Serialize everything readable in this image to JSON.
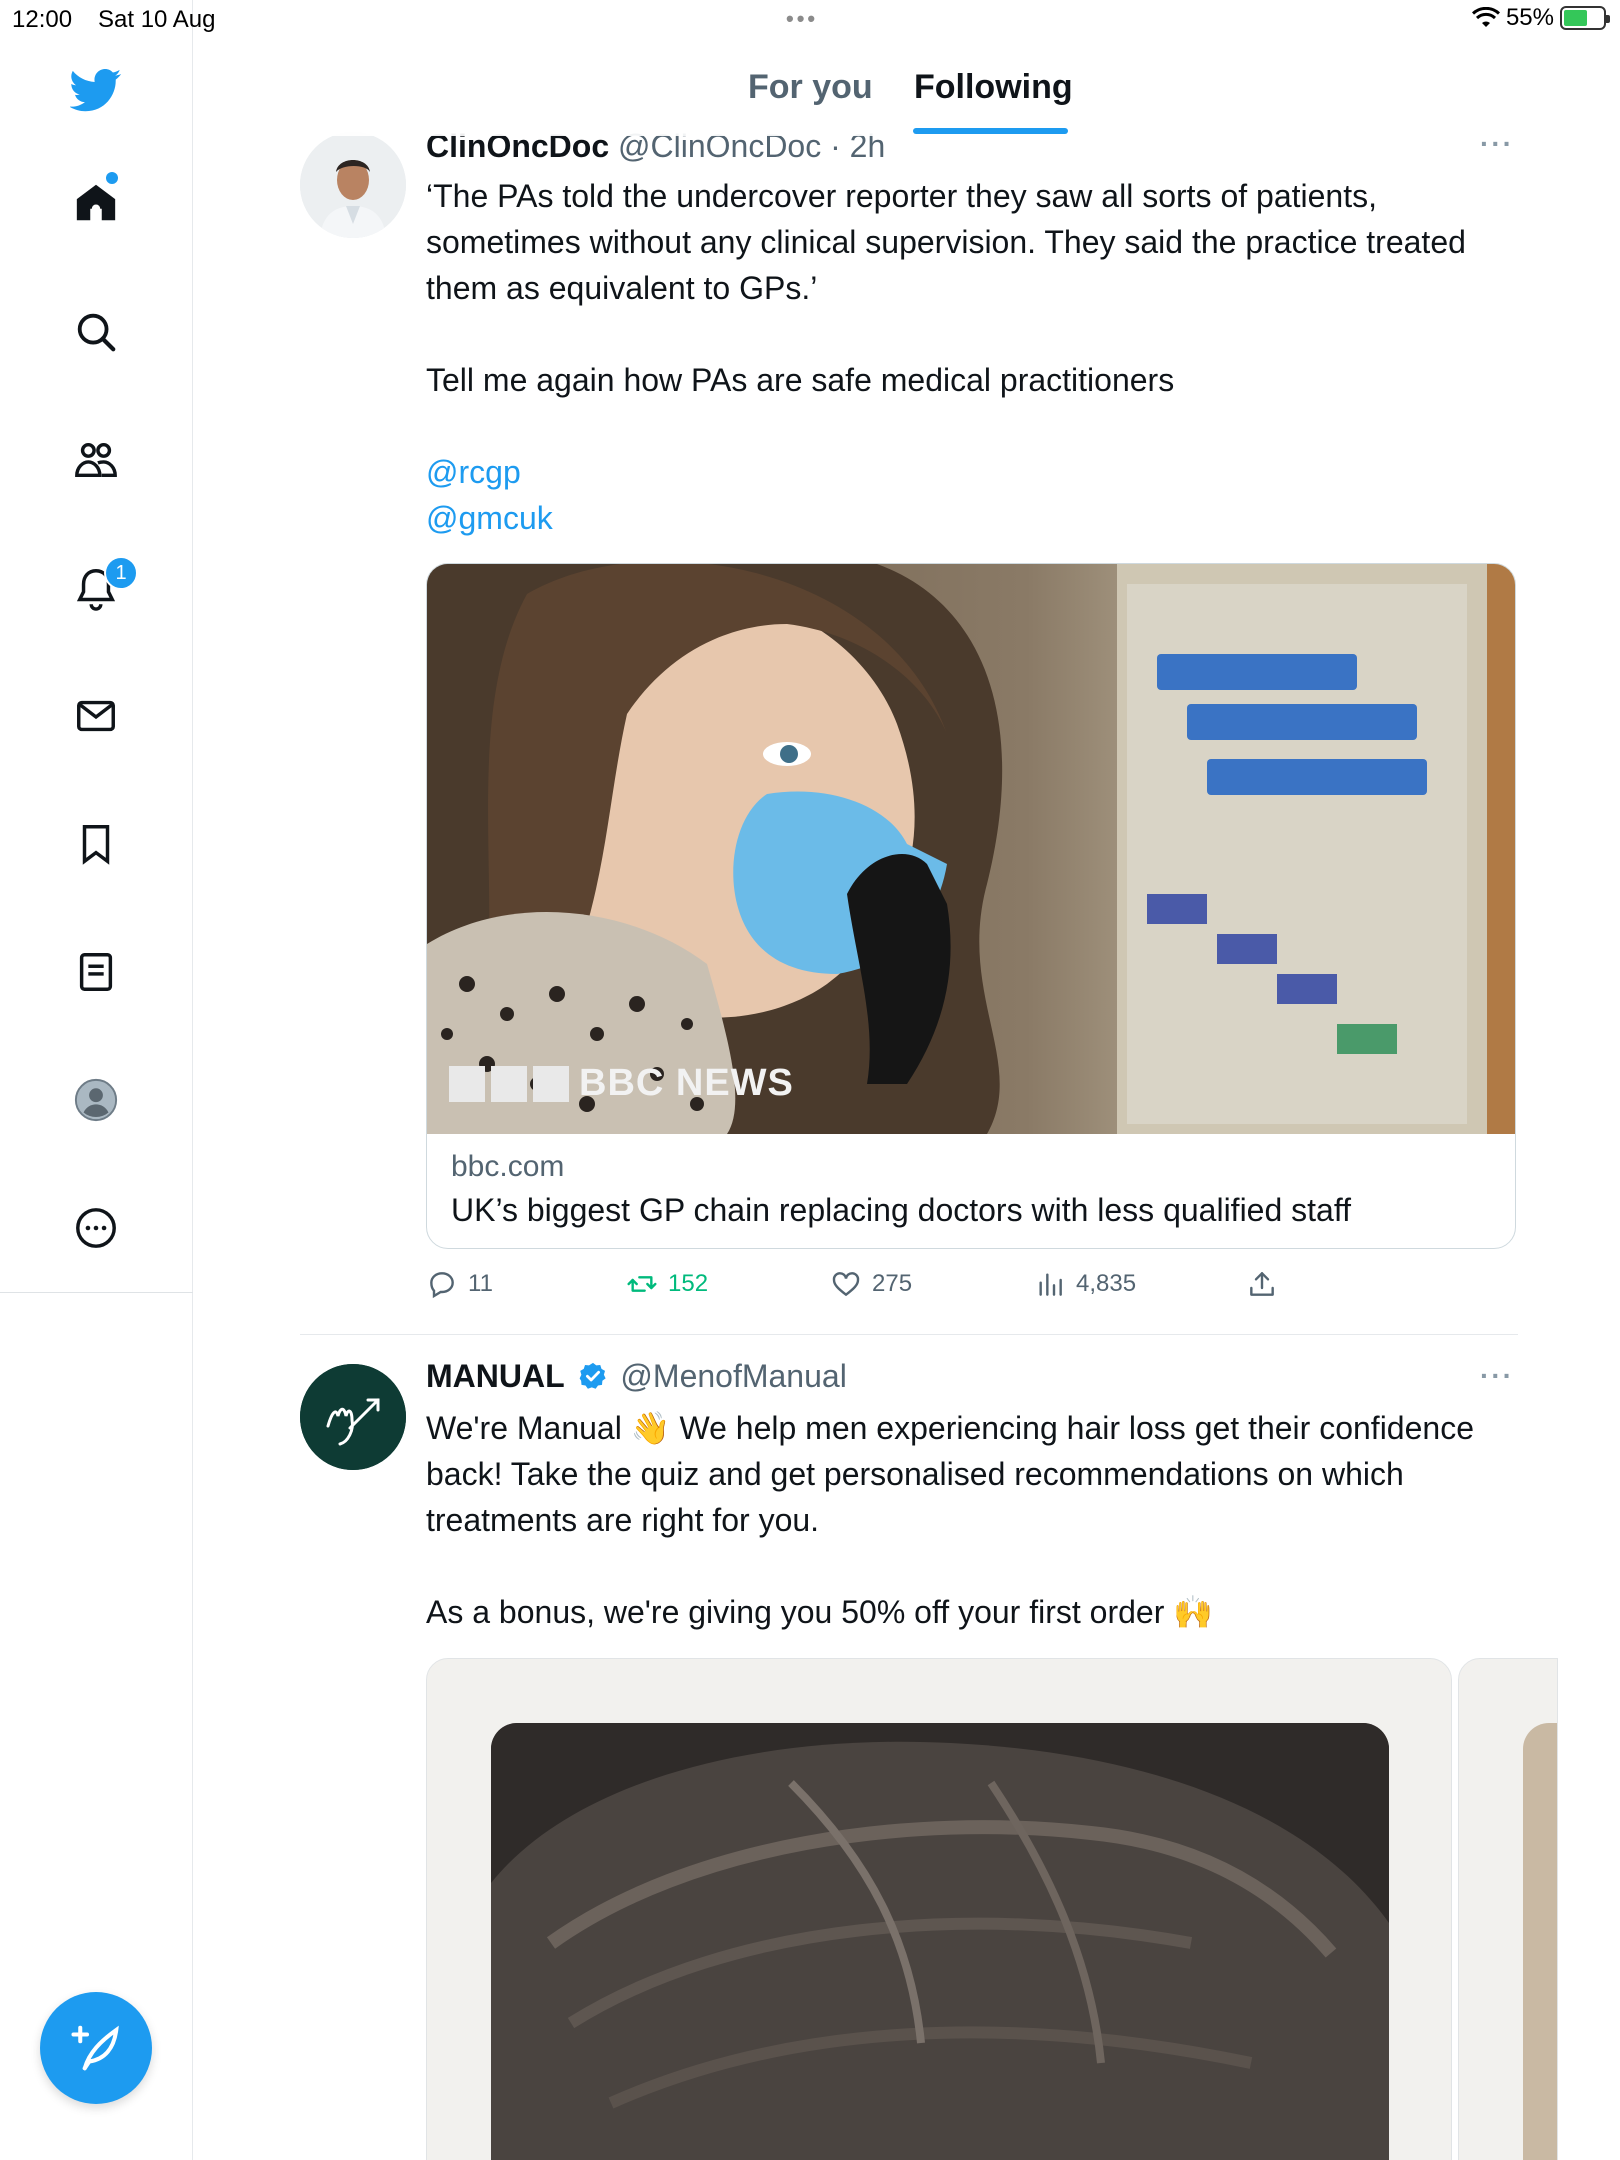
{
  "status_bar": {
    "time": "12:00",
    "date": "Sat 10 Aug",
    "battery": "55%",
    "multitask_dots": "•••"
  },
  "sidebar": {
    "items": [
      {
        "name": "twitter-logo",
        "icon": "bird-icon"
      },
      {
        "name": "home",
        "icon": "home-icon"
      },
      {
        "name": "explore",
        "icon": "search-icon"
      },
      {
        "name": "communities",
        "icon": "people-icon"
      },
      {
        "name": "notifications",
        "icon": "bell-icon",
        "badge": "1"
      },
      {
        "name": "messages",
        "icon": "mail-icon"
      },
      {
        "name": "bookmarks",
        "icon": "bookmark-icon"
      },
      {
        "name": "lists",
        "icon": "list-icon"
      },
      {
        "name": "profile",
        "icon": "avatar-icon"
      },
      {
        "name": "more",
        "icon": "more-circle-icon"
      }
    ],
    "compose_icon": "compose-icon"
  },
  "tabs": {
    "for_you": "For you",
    "following": "Following",
    "active": "Following"
  },
  "tweet1": {
    "name": "ClinOncDoc",
    "handle": "@ClinOncDoc · 2h",
    "more": "···",
    "text_p1": "‘The PAs told the undercover reporter they saw all sorts of patients, sometimes without any clinical supervision. They said the practice treated them as equivalent to GPs.’",
    "text_p2": "Tell me again how PAs are safe medical practitioners",
    "mention1": "@rcgp",
    "mention2": "@gmcuk",
    "card": {
      "watermark": "BBC NEWS",
      "domain": "bbc.com",
      "headline": "UK’s biggest GP chain replacing doctors with less qualified staff"
    },
    "actions": {
      "replies": "11",
      "retweets": "152",
      "likes": "275",
      "views": "4,835"
    }
  },
  "tweet2": {
    "name": "MANUAL",
    "handle": "@MenofManual",
    "more": "···",
    "text_p1": "We're Manual 👋 We help men experiencing hair loss get their confidence back! Take the quiz and get personalised recommendations on which treatments are right for you.",
    "text_p2": "As a bonus, we're giving you 50% off your first order 🙌",
    "accent": "#0e3b34"
  },
  "colors": {
    "accent_blue": "#1d9bf0",
    "retweet_green": "#00ba7c",
    "secondary_text": "#536471"
  }
}
